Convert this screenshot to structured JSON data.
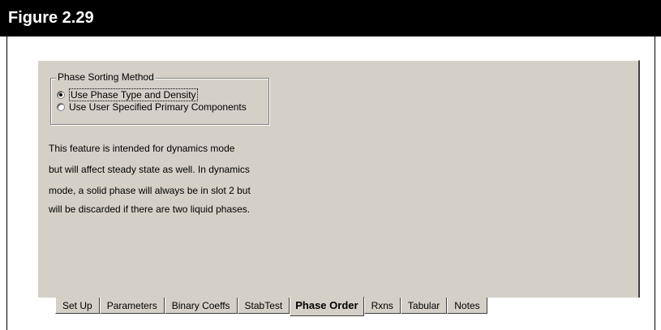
{
  "figure": {
    "title": "Figure 2.29"
  },
  "phase_sorting": {
    "group_label": "Phase Sorting Method",
    "options": [
      {
        "label": "Use Phase Type and Density",
        "selected": true
      },
      {
        "label": "Use User Specified Primary Components",
        "selected": false
      }
    ]
  },
  "description": {
    "lines": [
      "This feature is intended for dynamics mode",
      "but will affect steady state as well. In dynamics",
      "mode, a solid phase will always be in slot 2 but",
      "will be discarded if there are two liquid phases."
    ]
  },
  "tabs": {
    "items": [
      {
        "label": "Set Up"
      },
      {
        "label": "Parameters"
      },
      {
        "label": "Binary Coeffs"
      },
      {
        "label": "StabTest"
      },
      {
        "label": "Phase Order"
      },
      {
        "label": "Rxns"
      },
      {
        "label": "Tabular"
      },
      {
        "label": "Notes"
      }
    ],
    "active": "Phase Order"
  },
  "colors": {
    "header_background": "#000000",
    "header_text": "#ffffff",
    "dialog_background": "#d4d0c8"
  }
}
